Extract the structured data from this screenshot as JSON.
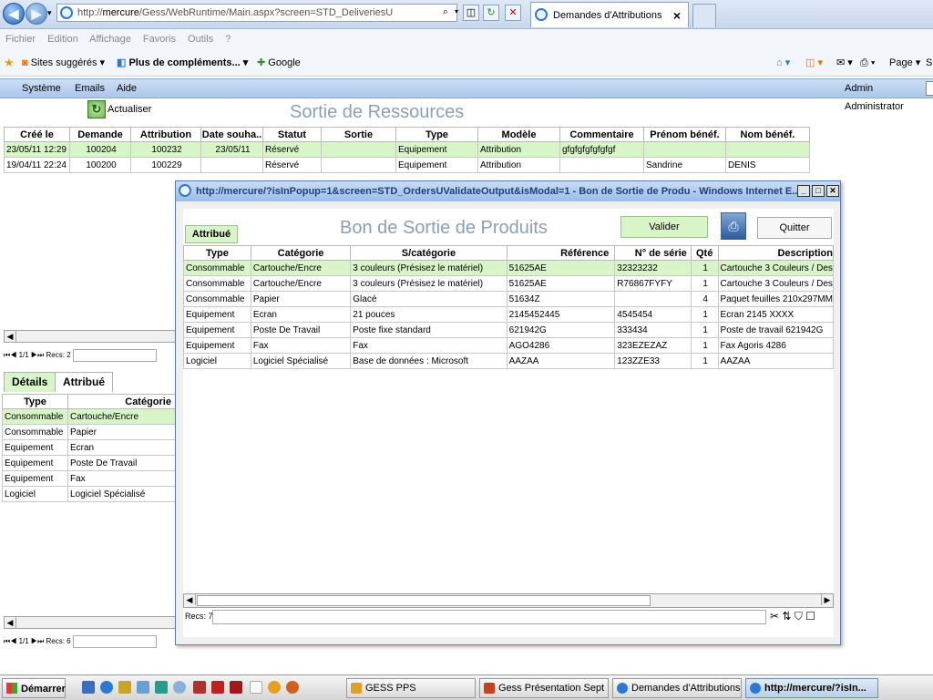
{
  "browser": {
    "url_prefix": "http://",
    "url_host": "mercure",
    "url_rest": "/Gess/WebRuntime/Main.aspx?screen=STD_DeliveriesU",
    "tab_title": "Demandes d'Attributions",
    "tab_close": "×",
    "menu": [
      "Fichier",
      "Edition",
      "Affichage",
      "Favoris",
      "Outils",
      "?"
    ],
    "favorites": {
      "suggested": "Sites suggérés ▾",
      "more": "Plus de compléments... ▾",
      "google": "Google"
    },
    "page_menu": "Page ▾",
    "safety_s": "S"
  },
  "app": {
    "menu": [
      "Système",
      "Emails",
      "Aide"
    ],
    "user": "Admin Administrator",
    "title": "Sortie de Ressources",
    "refresh_label": "Actualiser"
  },
  "main_grid": {
    "headers": [
      "Créé le",
      "Demande",
      "Attribution",
      "Date souha..",
      "Statut",
      "Sortie",
      "Type",
      "Modèle",
      "Commentaire",
      "Prénom bénéf.",
      "Nom bénéf."
    ],
    "rows": [
      [
        "23/05/11 12:29",
        "100204",
        "100232",
        "23/05/11",
        "Réservé",
        "",
        "Equipement",
        "Attribution",
        "gfgfgfgfgfgfgf",
        "",
        ""
      ],
      [
        "19/04/11 22:24",
        "100200",
        "100229",
        "",
        "Réservé",
        "",
        "Equipement",
        "Attribution",
        "",
        "Sandrine",
        "DENIS"
      ]
    ]
  },
  "left_panel": {
    "pager1": "1/1",
    "recs1": "Recs: 2",
    "tabs": [
      "Détails",
      "Attribué"
    ],
    "headers": [
      "Type",
      "Catégorie"
    ],
    "rows": [
      [
        "Consommable",
        "Cartouche/Encre"
      ],
      [
        "Consommable",
        "Papier"
      ],
      [
        "Equipement",
        "Ecran"
      ],
      [
        "Equipement",
        "Poste De Travail"
      ],
      [
        "Equipement",
        "Fax"
      ],
      [
        "Logiciel",
        "Logiciel Spécialisé"
      ]
    ],
    "pager2": "1/1",
    "recs2": "Recs: 6"
  },
  "popup": {
    "window_title": "http://mercure/?isInPopup=1&screen=STD_OrdersUValidateOutput&isModal=1 - Bon de Sortie de Produ - Windows Internet E...",
    "tab": "Attribué",
    "title": "Bon de Sortie de Produits",
    "validate": "Valider",
    "quit": "Quitter",
    "headers": [
      "Type",
      "Catégorie",
      "S/catégorie",
      "Référence",
      "N° de série",
      "Qté",
      "Description"
    ],
    "rows": [
      [
        "Consommable",
        "Cartouche/Encre",
        "3 couleurs (Présisez le matériel)",
        "51625AE",
        "32323232",
        "1",
        "Cartouche 3 Couleurs / Des"
      ],
      [
        "Consommable",
        "Cartouche/Encre",
        "3 couleurs (Présisez le matériel)",
        "51625AE",
        "R76867FYFY",
        "1",
        "Cartouche 3 Couleurs / Des"
      ],
      [
        "Consommable",
        "Papier",
        "Glacé",
        "51634Z",
        "",
        "4",
        "Paquet feuilles 210x297MM"
      ],
      [
        "Equipement",
        "Ecran",
        "21 pouces",
        "2145452445",
        "4545454",
        "1",
        "Ecran 2145 XXXX"
      ],
      [
        "Equipement",
        "Poste De Travail",
        "Poste fixe standard",
        "621942G",
        "333434",
        "1",
        "Poste de travail 621942G"
      ],
      [
        "Equipement",
        "Fax",
        "Fax",
        "AGO4286",
        "323EZEZAZ",
        "1",
        "Fax Agoris 4286"
      ],
      [
        "Logiciel",
        "Logiciel Spécialisé",
        "Base de données : Microsoft",
        "AAZAA",
        "123ZZE33",
        "1",
        "AAZAA"
      ]
    ],
    "recs": "Recs: 7"
  },
  "taskbar": {
    "start": "Démarrer",
    "tasks": [
      "GESS PPS",
      "Gess Présentation Sept ...",
      "Demandes d'Attributions ...",
      "http://mercure/?isIn..."
    ]
  },
  "colors": {
    "selected_row": "#d8f5c8",
    "title_text": "#8aa0b8",
    "menu_bar": "#aac6ea"
  }
}
